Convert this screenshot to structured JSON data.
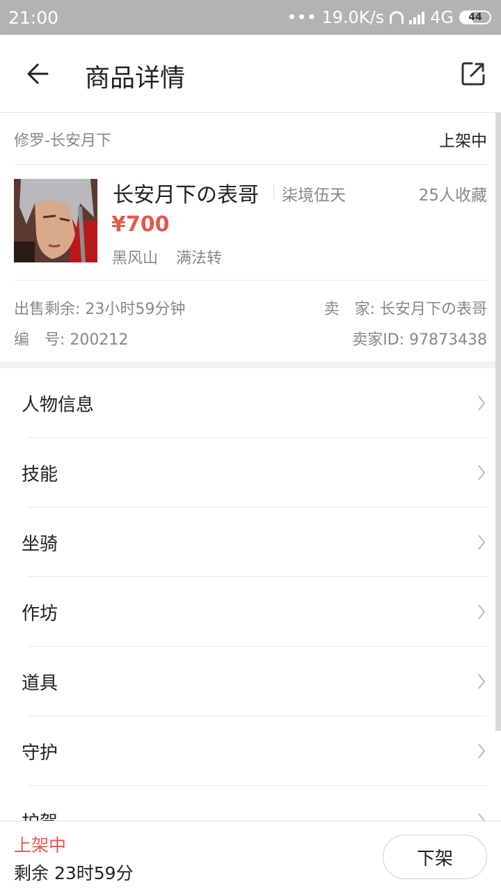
{
  "status_bar": {
    "time": "21:00",
    "net_speed": "••• 19.0K/s",
    "network": "4G",
    "battery": "44",
    "battery_level": 0.44
  },
  "header": {
    "title": "商品详情",
    "back_icon": "back-arrow-icon",
    "share_icon": "share-icon"
  },
  "goods": {
    "server": "修罗-长安月下",
    "status": "上架中",
    "name": "长安月下の表哥",
    "guild": "柒境伍天",
    "favorites": "25人收藏",
    "price": "¥700",
    "faction": "黑风山",
    "reincarnation": "满法转",
    "sale_remaining": "出售剩余: 23小时59分钟",
    "seller": "卖　家: 长安月下の表哥",
    "number": "编　号: 200212",
    "seller_id": "卖家ID: 97873438"
  },
  "menu": [
    {
      "label": "人物信息"
    },
    {
      "label": "技能"
    },
    {
      "label": "坐骑"
    },
    {
      "label": "作坊"
    },
    {
      "label": "道具"
    },
    {
      "label": "守护"
    },
    {
      "label": "护驾"
    }
  ],
  "bottom": {
    "status": "上架中",
    "remaining": "剩余 23时59分",
    "delist_label": "下架"
  },
  "colors": {
    "accent_red": "#e05a4e",
    "status_bar_bg": "#b3b3b3"
  }
}
